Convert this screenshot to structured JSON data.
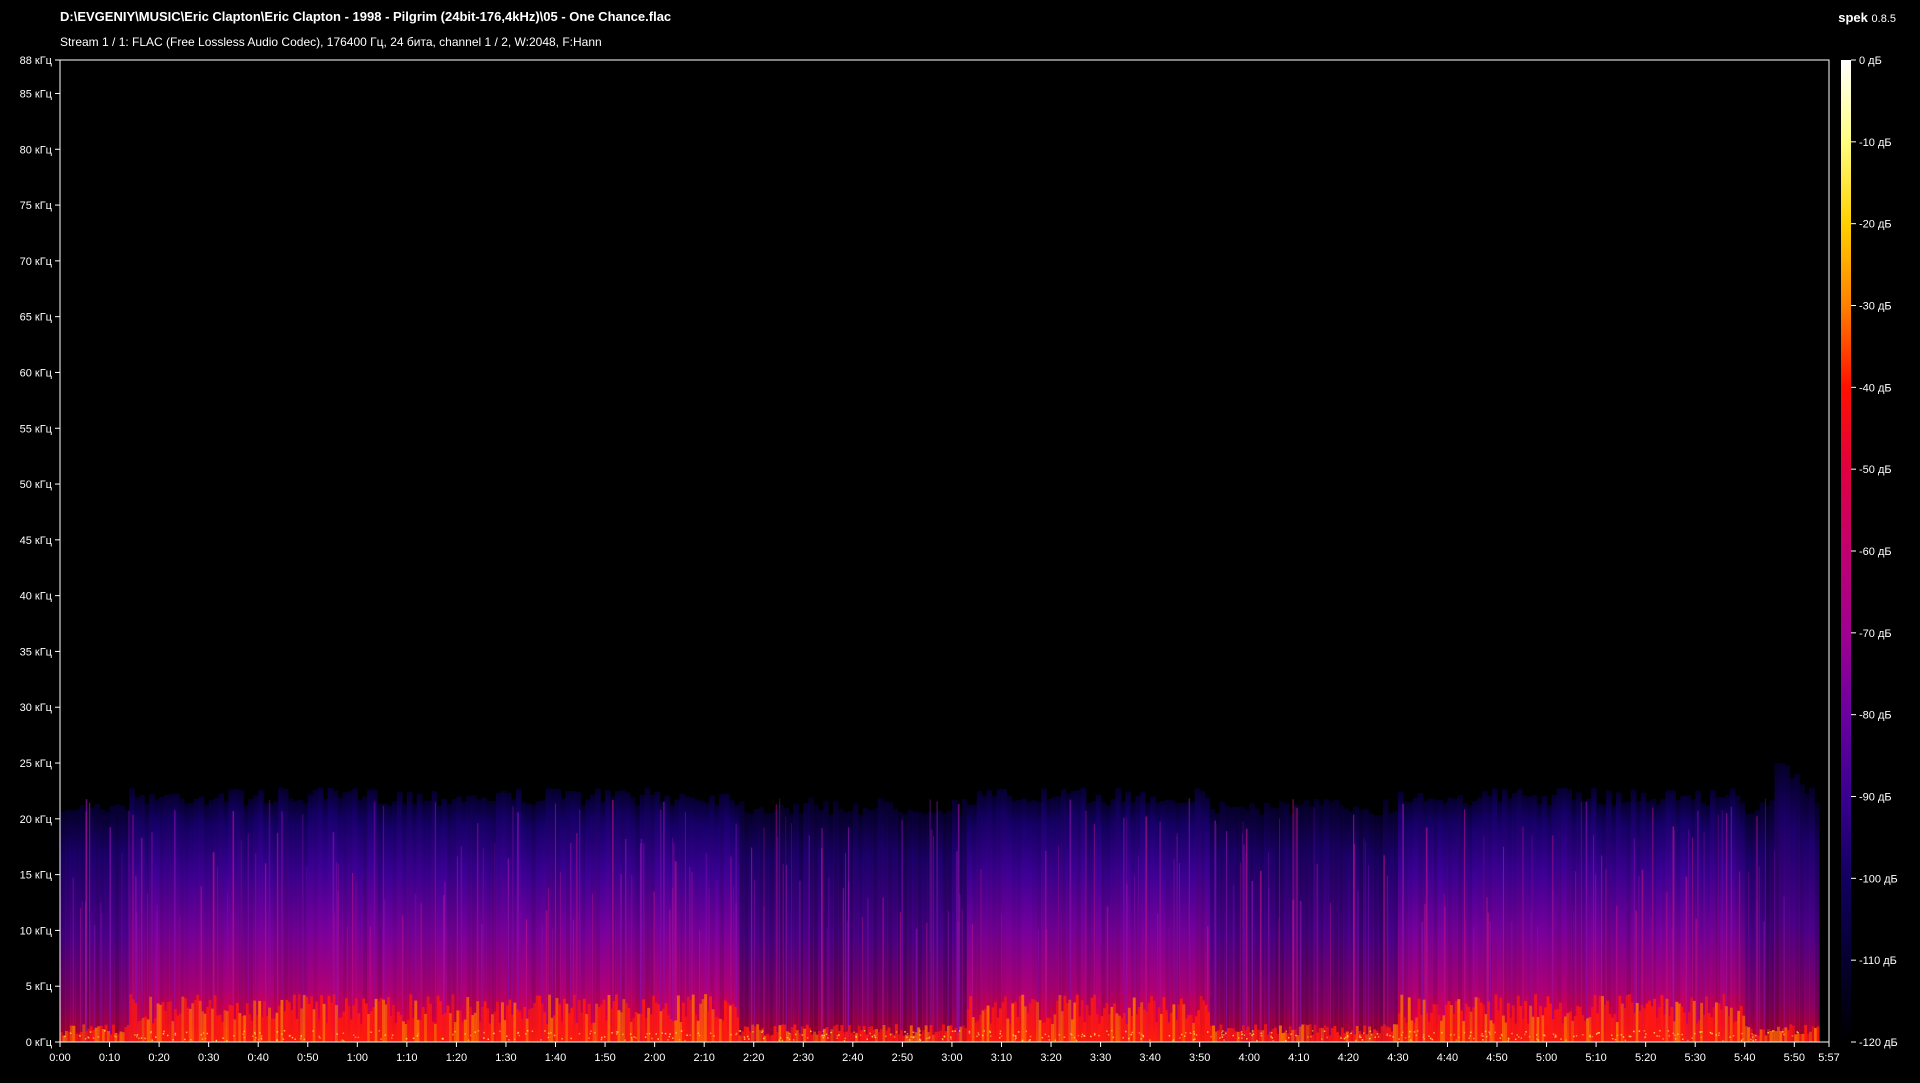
{
  "header": {
    "file_path": "D:\\EVGENIY\\MUSIC\\Eric Clapton\\Eric Clapton - 1998 - Pilgrim (24bit-176,4kHz)\\05 - One Chance.flac",
    "stream_info": "Stream 1 / 1: FLAC (Free Lossless Audio Codec), 176400 Гц, 24 бита, channel 1 / 2, W:2048, F:Hann",
    "app_name": "spek",
    "app_version": "0.8.5"
  },
  "chart_data": {
    "type": "heatmap",
    "x_unit": "time (m:ss)",
    "y_unit": "кГц",
    "x_range_seconds": [
      0,
      357
    ],
    "y_range_khz": [
      0,
      88
    ],
    "x_tick_labels": [
      "0:00",
      "0:10",
      "0:20",
      "0:30",
      "0:40",
      "0:50",
      "1:00",
      "1:10",
      "1:20",
      "1:30",
      "1:40",
      "1:50",
      "2:00",
      "2:10",
      "2:20",
      "2:30",
      "2:40",
      "2:50",
      "3:00",
      "3:10",
      "3:20",
      "3:30",
      "3:40",
      "3:50",
      "4:00",
      "4:10",
      "4:20",
      "4:30",
      "4:40",
      "4:50",
      "5:00",
      "5:10",
      "5:20",
      "5:30",
      "5:40",
      "5:50",
      "5:57"
    ],
    "x_tick_values": [
      0,
      10,
      20,
      30,
      40,
      50,
      60,
      70,
      80,
      90,
      100,
      110,
      120,
      130,
      140,
      150,
      160,
      170,
      180,
      190,
      200,
      210,
      220,
      230,
      240,
      250,
      260,
      270,
      280,
      290,
      300,
      310,
      320,
      330,
      340,
      350,
      357
    ],
    "y_tick_labels": [
      "0 кГц",
      "5 кГц",
      "10 кГц",
      "15 кГц",
      "20 кГц",
      "25 кГц",
      "30 кГц",
      "35 кГц",
      "40 кГц",
      "45 кГц",
      "50 кГц",
      "55 кГц",
      "60 кГц",
      "65 кГц",
      "70 кГц",
      "75 кГц",
      "80 кГц",
      "85 кГц",
      "88 кГц"
    ],
    "y_tick_values": [
      0,
      5,
      10,
      15,
      20,
      25,
      30,
      35,
      40,
      45,
      50,
      55,
      60,
      65,
      70,
      75,
      80,
      85,
      88
    ],
    "colorbar": {
      "unit": "дБ",
      "range_db": [
        -120,
        0
      ],
      "tick_labels": [
        "0 дБ",
        "-10 дБ",
        "-20 дБ",
        "-30 дБ",
        "-40 дБ",
        "-50 дБ",
        "-60 дБ",
        "-70 дБ",
        "-80 дБ",
        "-90 дБ",
        "-100 дБ",
        "-110 дБ",
        "-120 дБ"
      ],
      "tick_values": [
        0,
        -10,
        -20,
        -30,
        -40,
        -50,
        -60,
        -70,
        -80,
        -90,
        -100,
        -110,
        -120
      ],
      "colors": [
        "#ffffff",
        "#ffff80",
        "#ffd000",
        "#ff8000",
        "#ff1000",
        "#e00040",
        "#c00070",
        "#a00090",
        "#6a00a0",
        "#3a0090",
        "#120060",
        "#050030",
        "#000000"
      ]
    },
    "content": {
      "energy_cutoff_khz": 22,
      "signal_start_s": 0,
      "signal_end_s": 355,
      "loud_sections_s": [
        [
          14,
          137
        ],
        [
          183,
          232
        ],
        [
          270,
          340
        ]
      ],
      "quiet_sections_s": [
        [
          0,
          14
        ],
        [
          137,
          183
        ],
        [
          232,
          270
        ],
        [
          340,
          357
        ]
      ]
    }
  }
}
